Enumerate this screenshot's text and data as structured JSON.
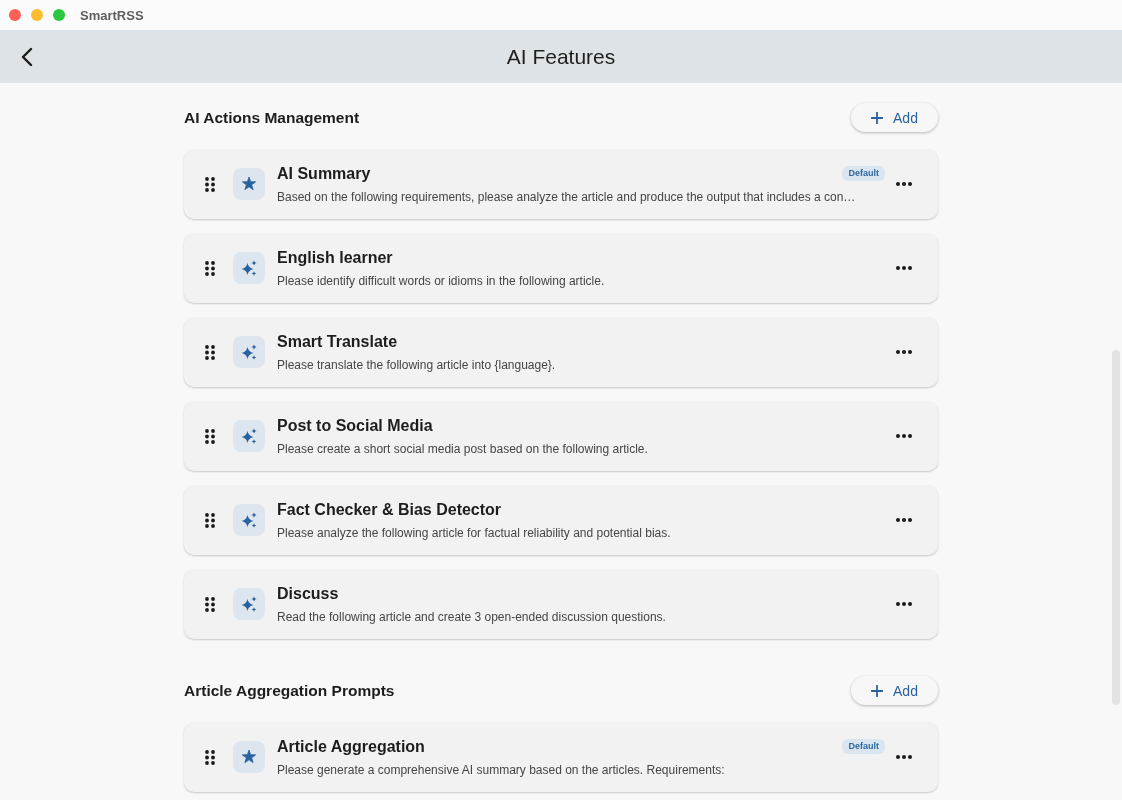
{
  "window": {
    "title": "SmartRSS"
  },
  "app_bar": {
    "title": "AI Features"
  },
  "sections": [
    {
      "title": "AI Actions Management",
      "add_button": {
        "label": "Add"
      },
      "items": [
        {
          "kind": "default",
          "title": "AI Summary",
          "badge": "Default",
          "description": "Based on the following requirements, please analyze the article and produce the output that includes a con…"
        },
        {
          "kind": "custom",
          "title": "English learner",
          "description": "Please identify difficult words or idioms in the following article."
        },
        {
          "kind": "custom",
          "title": "Smart Translate",
          "description": "Please translate the following article into {language}."
        },
        {
          "kind": "custom",
          "title": "Post to Social Media",
          "description": "Please create a short social media post based on the following article."
        },
        {
          "kind": "custom",
          "title": "Fact Checker & Bias Detector",
          "description": "Please analyze the following article for factual reliability and potential bias."
        },
        {
          "kind": "custom",
          "title": "Discuss",
          "description": "Read the following article and create 3 open-ended discussion questions."
        }
      ]
    },
    {
      "title": "Article Aggregation Prompts",
      "add_button": {
        "label": "Add"
      },
      "items": [
        {
          "kind": "default",
          "title": "Article Aggregation",
          "badge": "Default",
          "description": "Please generate a comprehensive AI summary based on the articles. Requirements:"
        }
      ]
    }
  ]
}
